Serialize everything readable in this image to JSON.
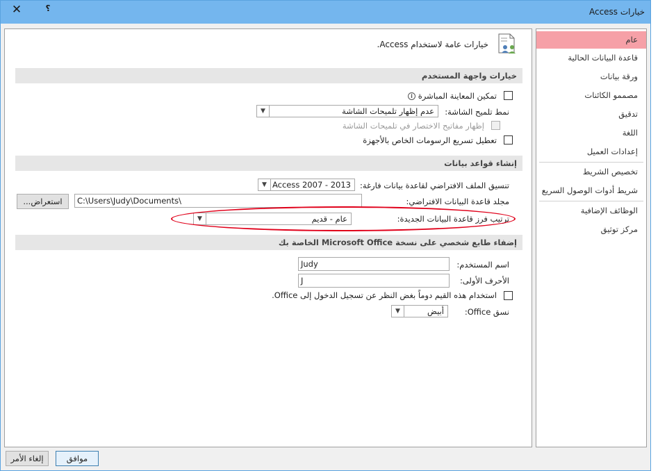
{
  "window": {
    "title": "خيارات Access",
    "close_glyph": "✕",
    "help_glyph": "؟"
  },
  "nav": {
    "items": [
      {
        "label": "عام"
      },
      {
        "label": "قاعدة البيانات الحالية"
      },
      {
        "label": "ورقة بيانات"
      },
      {
        "label": "مصممو الكائنات"
      },
      {
        "label": "تدقيق"
      },
      {
        "label": "اللغة"
      },
      {
        "label": "إعدادات العميل"
      },
      {
        "label": "تخصيص الشريط"
      },
      {
        "label": "شريط أدوات الوصول السريع"
      },
      {
        "label": "الوظائف الإضافية"
      },
      {
        "label": "مركز توثيق"
      }
    ],
    "active_index": 0
  },
  "header": {
    "text": "خيارات عامة لاستخدام Access."
  },
  "sections": {
    "ui_options": "خيارات واجهة المستخدم",
    "create_db": "إنشاء قواعد بيانات",
    "personalize": "إضفاء طابع شخصي على نسخة Microsoft Office الخاصة بك"
  },
  "ui_options": {
    "live_preview_label": "تمكين المعاينة المباشرة",
    "live_preview_checked": false,
    "info_glyph": "i",
    "screentip_label": "نمط تلميح الشاشة:",
    "screentip_value": "عدم إظهار تلميحات الشاشة",
    "shortcut_keys_label": "إظهار مفاتيح الاختصار في تلميحات الشاشة",
    "shortcut_keys_checked": false,
    "hw_accel_label": "تعطيل تسريع الرسومات الخاص بالأجهزة",
    "hw_accel_checked": false
  },
  "create_db": {
    "format_label": "تنسيق الملف الافتراضي لقاعدة بيانات فارغة:",
    "format_value": "Access 2007 - 2013",
    "folder_label": "مجلد قاعدة البيانات الافتراضي:",
    "folder_value": "C:\\Users\\Judy\\Documents\\",
    "browse_label": "استعراض...",
    "sort_label": "ترتيب فرز قاعدة البيانات الجديدة:",
    "sort_value": "عام - قديم"
  },
  "personalize": {
    "username_label": "اسم المستخدم:",
    "username_value": "Judy",
    "initials_label": "الأحرف الأولى:",
    "initials_value": "J",
    "always_use_label": "استخدام هذه القيم دوماً بغض النظر عن تسجيل الدخول إلى Office.",
    "always_use_checked": false,
    "theme_label": "نسق Office:",
    "theme_value": "أبيض"
  },
  "footer": {
    "ok_label": "موافق",
    "cancel_label": "إلغاء الأمر"
  },
  "colors": {
    "titlebar": "#74b6ee",
    "nav_active": "#f6a0a7",
    "highlight": "#e0001a"
  }
}
